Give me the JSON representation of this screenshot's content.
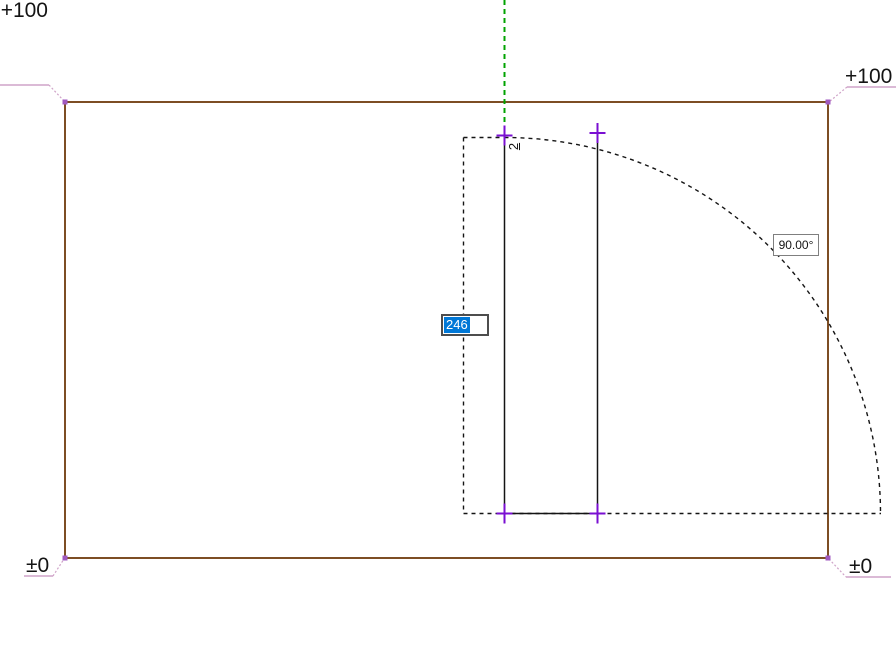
{
  "elevation_markers": {
    "top_left": "+100",
    "top_right": "+100",
    "bottom_left": "±0",
    "bottom_right": "±0"
  },
  "tracker": {
    "length_value": "246",
    "length_selected": true,
    "angle_value": "90.00°"
  },
  "cursor": {
    "badge": "2"
  },
  "colors": {
    "wall_outline": "#7d4e24",
    "marker_leader": "#cfa3c8",
    "corner_handle": "#a05ac0",
    "guide_line": "#00a300",
    "ghost_outline": "#141414",
    "vertex_cross": "#7a0fd2",
    "selection_background": "#0078d7",
    "input_border": "#4d4d4d",
    "readout_border": "#7f7f7f"
  }
}
